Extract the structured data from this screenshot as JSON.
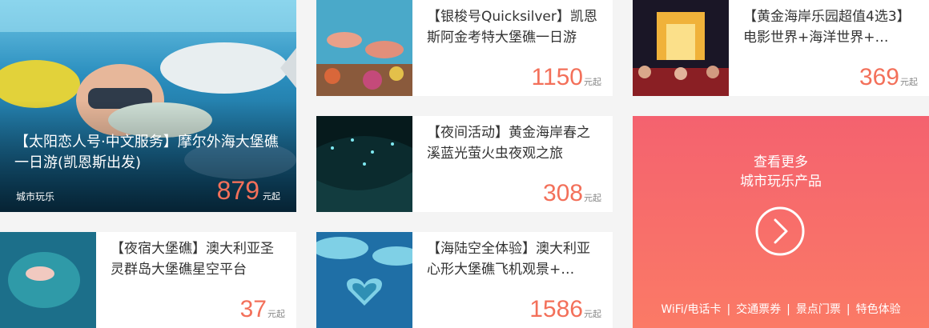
{
  "feature": {
    "title": "【太阳恋人号·中文服务】摩尔外海大堡礁一日游(凯恩斯出发)",
    "tag": "城市玩乐",
    "price": "879",
    "suffix": "元起"
  },
  "products": [
    {
      "title": "【银梭号Quicksilver】凯恩斯阿金考特大堡礁一日游",
      "price": "1150",
      "suffix": "元起"
    },
    {
      "title": "【黄金海岸乐园超值4选3】电影世界+海洋世界+…",
      "price": "369",
      "suffix": "元起"
    },
    {
      "title": "【夜间活动】黄金海岸春之溪蓝光萤火虫夜观之旅",
      "price": "308",
      "suffix": "元起"
    },
    {
      "title": "【夜宿大堡礁】澳大利亚圣灵群岛大堡礁星空平台",
      "price": "37",
      "suffix": "元起"
    },
    {
      "title": "【海陆空全体验】澳大利亚心形大堡礁飞机观景+…",
      "price": "1586",
      "suffix": "元起"
    }
  ],
  "promo": {
    "line1": "查看更多",
    "line2": "城市玩乐产品",
    "links": [
      "WiFi/电话卡",
      "交通票券",
      "景点门票",
      "特色体验"
    ],
    "separator": "|"
  },
  "colors": {
    "price": "#f3705a",
    "promo_top": "#f4626f",
    "promo_bottom": "#fb7a66"
  }
}
